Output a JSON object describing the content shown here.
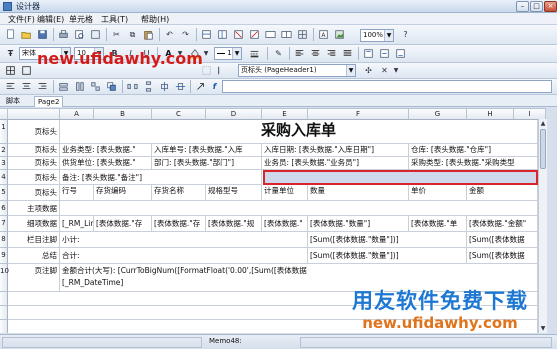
{
  "window": {
    "title": "设计器"
  },
  "menu": [
    "文件(F)",
    "编辑(E)",
    "单元格",
    "工具(T)",
    "帮助(H)"
  ],
  "toolbar": {
    "font_name": "宋体",
    "font_size": "10",
    "bold": "B",
    "italic": "I",
    "underline": "U",
    "font_color": "A",
    "line_width": "1",
    "zoom": "100%",
    "band_type": "页标头 (PageHeader1)"
  },
  "tabs": [
    "脚本",
    "Page2"
  ],
  "columns": [
    "A",
    "B",
    "C",
    "D",
    "E",
    "F",
    "G",
    "H",
    "I"
  ],
  "rows": [
    {
      "num": "1",
      "band": "页标头",
      "cells": [
        {
          "text": "采购入库单"
        }
      ]
    },
    {
      "num": "2",
      "band": "页标头",
      "cells": [
        {
          "text": "业务类型: [表头数据.\""
        },
        {
          "text": "入库单号: [表头数据.\"入库"
        },
        {
          "text": "入库日期: [表头数据.\"入库日期\"]"
        },
        {
          "text": "仓库: [表头数据.\"仓库\"]"
        }
      ]
    },
    {
      "num": "3",
      "band": "页标头",
      "cells": [
        {
          "text": "供货单位: [表头数据.\""
        },
        {
          "text": "部门: [表头数据.\"部门\"]"
        },
        {
          "text": "业务员: [表头数据.\"业务员\"]"
        },
        {
          "text": "采购类型: [表头数据.\"采购类型"
        }
      ]
    },
    {
      "num": "4",
      "band": "页标头",
      "cells": [
        {
          "text": "备注: [表头数据.\"备注\"]"
        }
      ]
    },
    {
      "num": "5",
      "band": "页标头",
      "cells": [
        {
          "text": "行号"
        },
        {
          "text": "存货编码"
        },
        {
          "text": "存货名称"
        },
        {
          "text": "规格型号"
        },
        {
          "text": "计量单位"
        },
        {
          "text": "数量"
        },
        {
          "text": "单价"
        },
        {
          "text": "金额"
        }
      ]
    },
    {
      "num": "6",
      "band": "主项数据",
      "cells": []
    },
    {
      "num": "7",
      "band": "细项数据",
      "cells": [
        {
          "text": "[_RM_Lin"
        },
        {
          "text": "[表体数据.\"存"
        },
        {
          "text": "[表体数据.\"存"
        },
        {
          "text": "[表体数据.\"规"
        },
        {
          "text": "[表体数据.\""
        },
        {
          "text": "[表体数据.\"数量\"]"
        },
        {
          "text": "[表体数据.\"单"
        },
        {
          "text": "[表体数据.\"金额\""
        }
      ]
    },
    {
      "num": "8",
      "band": "栏目注脚",
      "cells": [
        {
          "text": "小计:"
        },
        {
          "text": "[Sum([表体数据.\"数量\"])]"
        },
        {
          "text": "[Sum([表体数据"
        }
      ]
    },
    {
      "num": "9",
      "band": "总结",
      "cells": [
        {
          "text": "合计:"
        },
        {
          "text": "[Sum([表体数据.\"数量\"])]"
        },
        {
          "text": "[Sum([表体数据"
        }
      ]
    },
    {
      "num": "10",
      "band": "页注脚",
      "cells": [
        {
          "text": "金额合计(大写): [CurrToBigNum([FormatFloat('0.00',[Sum([表体数据"
        },
        {
          "text": "[_RM_DateTime]"
        }
      ]
    }
  ],
  "status": {
    "memo": "Memo48:"
  },
  "watermark": {
    "top": "new.ufidawhy.com",
    "bottom_line1": "用友软件免费下载",
    "bottom_line2": "new.ufidawhy.com"
  }
}
